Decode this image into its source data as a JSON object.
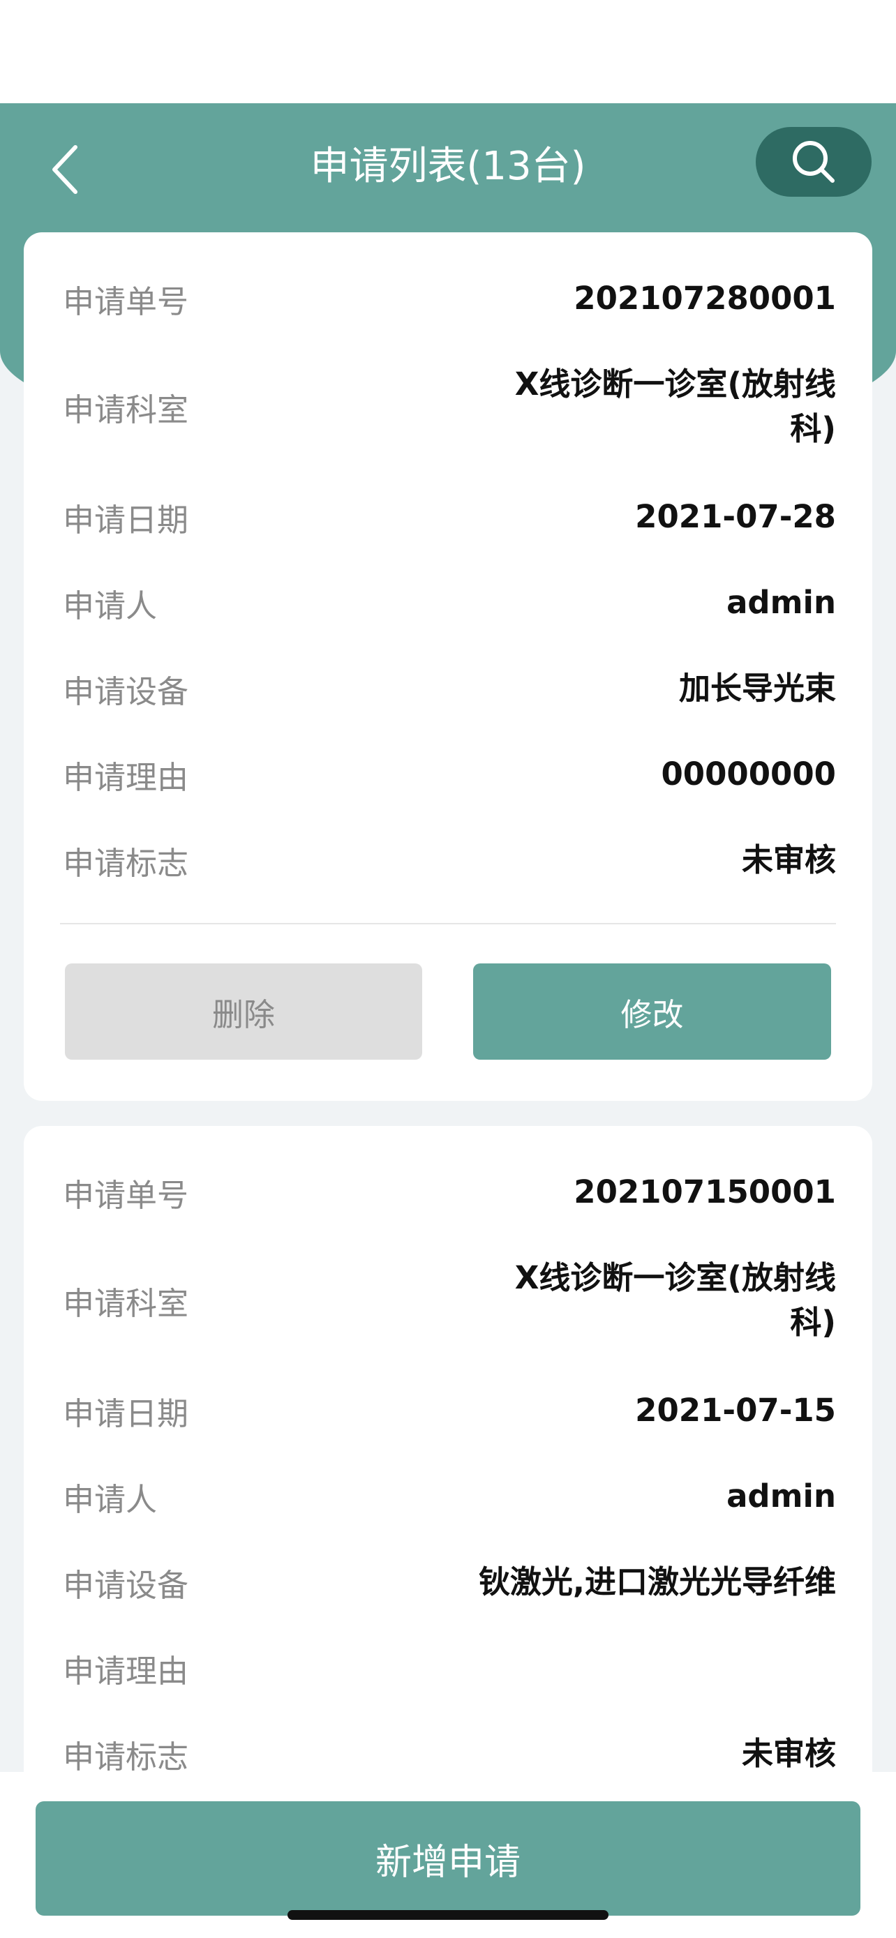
{
  "header": {
    "title": "申请列表(13台)",
    "back_icon": "chevron-left-icon",
    "search_icon": "search-icon",
    "color": "#63a49b",
    "search_button_color": "#2e6b63"
  },
  "labels": {
    "number": "申请单号",
    "department": "申请科室",
    "date": "申请日期",
    "applicant": "申请人",
    "equipment": "申请设备",
    "reason": "申请理由",
    "status": "申请标志"
  },
  "requests": [
    {
      "number": "202107280001",
      "department": "X线诊断一诊室(放射线科)",
      "date": "2021-07-28",
      "applicant": "admin",
      "equipment": "加长导光束",
      "reason": "00000000",
      "status": "未审核",
      "delete_label": "删除",
      "edit_label": "修改"
    },
    {
      "number": "202107150001",
      "department": "X线诊断一诊室(放射线科)",
      "date": "2021-07-15",
      "applicant": "admin",
      "equipment": "钬激光,进口激光光导纤维",
      "reason": "",
      "status": "未审核"
    }
  ],
  "footer": {
    "new_request_label": "新增申请"
  }
}
